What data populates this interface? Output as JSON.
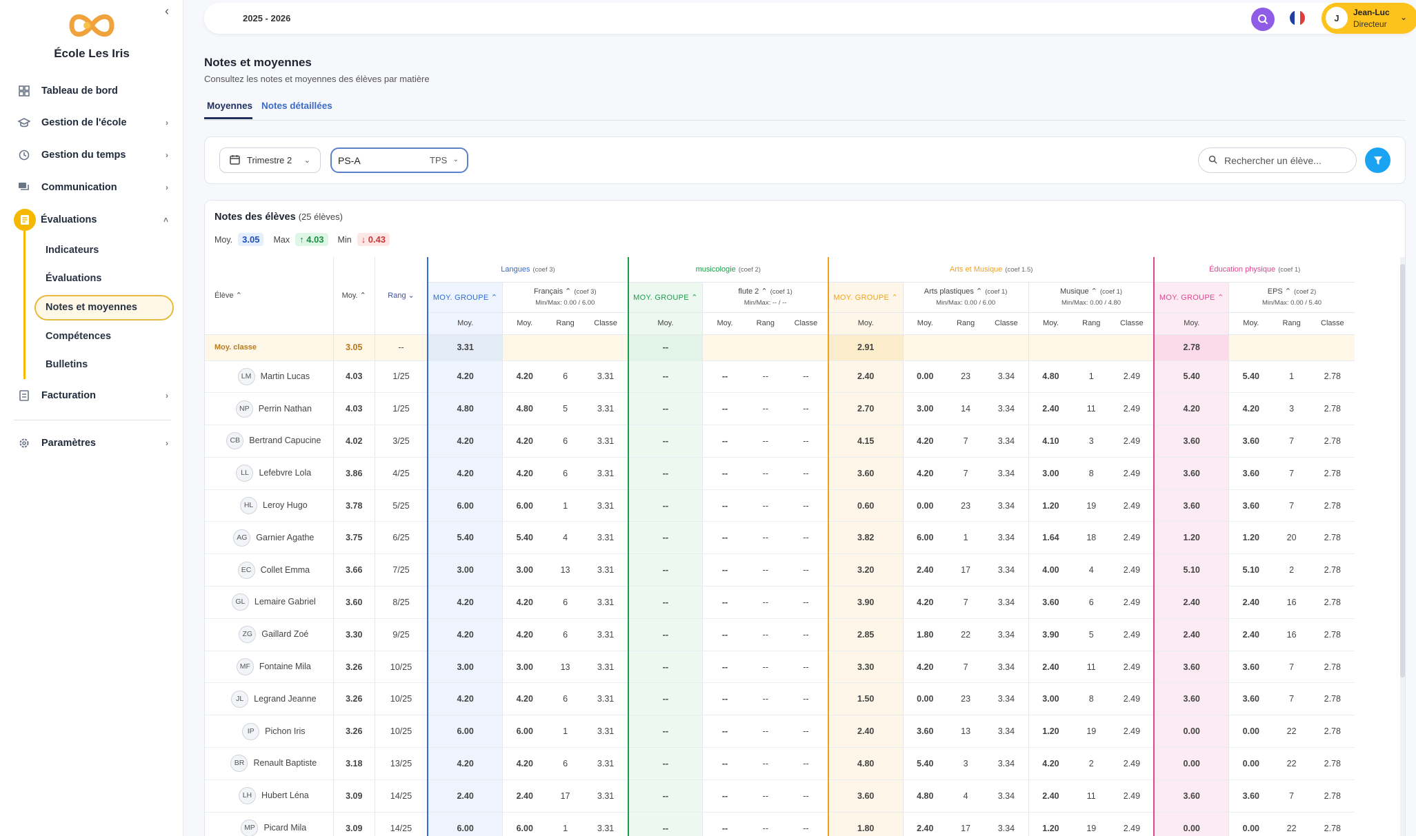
{
  "app": {
    "school": "École Les Iris",
    "year": "2025 - 2026"
  },
  "user": {
    "initial": "J",
    "name": "Jean-Luc",
    "role": "Directeur"
  },
  "sidebar": {
    "items": [
      {
        "label": "Tableau de bord"
      },
      {
        "label": "Gestion de l'école"
      },
      {
        "label": "Gestion du temps"
      },
      {
        "label": "Communication"
      },
      {
        "label": "Évaluations"
      },
      {
        "label": "Facturation"
      },
      {
        "label": "Paramètres"
      }
    ],
    "sub": [
      {
        "label": "Indicateurs"
      },
      {
        "label": "Évaluations"
      },
      {
        "label": "Notes et moyennes"
      },
      {
        "label": "Compétences"
      },
      {
        "label": "Bulletins"
      }
    ]
  },
  "page": {
    "title": "Notes et moyennes",
    "subtitle": "Consultez les notes et moyennes des élèves par matière",
    "tabs": [
      "Moyennes",
      "Notes détaillées"
    ]
  },
  "filters": {
    "trimestre": "Trimestre 2",
    "classe": "PS-A",
    "level": "TPS",
    "search_placeholder": "Rechercher un élève..."
  },
  "card": {
    "title": "Notes des élèves",
    "count": "(25 élèves)",
    "moy_label": "Moy.",
    "moy": "3.05",
    "max_label": "Max",
    "max": "↑ 4.03",
    "min_label": "Min",
    "min": "↓ 0.43"
  },
  "table": {
    "col_eleve": "Élève ⌃",
    "col_moy": "Moy. ⌃",
    "col_rang": "Rang ⌄",
    "groups": [
      {
        "name": "Langues",
        "coef": "(coef 3)"
      },
      {
        "name": "musicologie",
        "coef": "(coef 2)"
      },
      {
        "name": "Arts et Musique",
        "coef": "(coef 1.5)"
      },
      {
        "name": "Éducation physique",
        "coef": "(coef 1)"
      }
    ],
    "moy_groupe": "MOY. GROUPE ⌃",
    "subjects": [
      {
        "name": "Français",
        "coef": "(coef 3)",
        "minmax": "Min/Max: 0.00 / 6.00"
      },
      {
        "name": "flute 2",
        "coef": "(coef 1)",
        "minmax": "Min/Max: -- / --"
      },
      {
        "name": "Arts plastiques",
        "coef": "(coef 1)",
        "minmax": "Min/Max: 0.00 / 6.00"
      },
      {
        "name": "Musique",
        "coef": "(coef 1)",
        "minmax": "Min/Max: 0.00 / 4.80"
      },
      {
        "name": "EPS",
        "coef": "(coef 2)",
        "minmax": "Min/Max: 0.00 / 5.40"
      }
    ],
    "sub_moy": "Moy.",
    "sub_rang": "Rang",
    "sub_classe": "Classe",
    "avg_row": [
      "Moy. classe",
      "3.05",
      "--",
      "3.31",
      "--",
      "2.91",
      "2.78"
    ],
    "rows": [
      [
        "LM",
        "Martin Lucas",
        "4.03",
        "1/25",
        "4.20",
        "4.20",
        "6",
        "3.31",
        "--",
        "--",
        "--",
        "--",
        "2.40",
        "0.00",
        "23",
        "3.34",
        "4.80",
        "1",
        "2.49",
        "5.40",
        "5.40",
        "1",
        "2.78"
      ],
      [
        "NP",
        "Perrin Nathan",
        "4.03",
        "1/25",
        "4.80",
        "4.80",
        "5",
        "3.31",
        "--",
        "--",
        "--",
        "--",
        "2.70",
        "3.00",
        "14",
        "3.34",
        "2.40",
        "11",
        "2.49",
        "4.20",
        "4.20",
        "3",
        "2.78"
      ],
      [
        "CB",
        "Bertrand Capucine",
        "4.02",
        "3/25",
        "4.20",
        "4.20",
        "6",
        "3.31",
        "--",
        "--",
        "--",
        "--",
        "4.15",
        "4.20",
        "7",
        "3.34",
        "4.10",
        "3",
        "2.49",
        "3.60",
        "3.60",
        "7",
        "2.78"
      ],
      [
        "LL",
        "Lefebvre Lola",
        "3.86",
        "4/25",
        "4.20",
        "4.20",
        "6",
        "3.31",
        "--",
        "--",
        "--",
        "--",
        "3.60",
        "4.20",
        "7",
        "3.34",
        "3.00",
        "8",
        "2.49",
        "3.60",
        "3.60",
        "7",
        "2.78"
      ],
      [
        "HL",
        "Leroy Hugo",
        "3.78",
        "5/25",
        "6.00",
        "6.00",
        "1",
        "3.31",
        "--",
        "--",
        "--",
        "--",
        "0.60",
        "0.00",
        "23",
        "3.34",
        "1.20",
        "19",
        "2.49",
        "3.60",
        "3.60",
        "7",
        "2.78"
      ],
      [
        "AG",
        "Garnier Agathe",
        "3.75",
        "6/25",
        "5.40",
        "5.40",
        "4",
        "3.31",
        "--",
        "--",
        "--",
        "--",
        "3.82",
        "6.00",
        "1",
        "3.34",
        "1.64",
        "18",
        "2.49",
        "1.20",
        "1.20",
        "20",
        "2.78"
      ],
      [
        "EC",
        "Collet Emma",
        "3.66",
        "7/25",
        "3.00",
        "3.00",
        "13",
        "3.31",
        "--",
        "--",
        "--",
        "--",
        "3.20",
        "2.40",
        "17",
        "3.34",
        "4.00",
        "4",
        "2.49",
        "5.10",
        "5.10",
        "2",
        "2.78"
      ],
      [
        "GL",
        "Lemaire Gabriel",
        "3.60",
        "8/25",
        "4.20",
        "4.20",
        "6",
        "3.31",
        "--",
        "--",
        "--",
        "--",
        "3.90",
        "4.20",
        "7",
        "3.34",
        "3.60",
        "6",
        "2.49",
        "2.40",
        "2.40",
        "16",
        "2.78"
      ],
      [
        "ZG",
        "Gaillard Zoé",
        "3.30",
        "9/25",
        "4.20",
        "4.20",
        "6",
        "3.31",
        "--",
        "--",
        "--",
        "--",
        "2.85",
        "1.80",
        "22",
        "3.34",
        "3.90",
        "5",
        "2.49",
        "2.40",
        "2.40",
        "16",
        "2.78"
      ],
      [
        "MF",
        "Fontaine Mila",
        "3.26",
        "10/25",
        "3.00",
        "3.00",
        "13",
        "3.31",
        "--",
        "--",
        "--",
        "--",
        "3.30",
        "4.20",
        "7",
        "3.34",
        "2.40",
        "11",
        "2.49",
        "3.60",
        "3.60",
        "7",
        "2.78"
      ],
      [
        "JL",
        "Legrand Jeanne",
        "3.26",
        "10/25",
        "4.20",
        "4.20",
        "6",
        "3.31",
        "--",
        "--",
        "--",
        "--",
        "1.50",
        "0.00",
        "23",
        "3.34",
        "3.00",
        "8",
        "2.49",
        "3.60",
        "3.60",
        "7",
        "2.78"
      ],
      [
        "IP",
        "Pichon Iris",
        "3.26",
        "10/25",
        "6.00",
        "6.00",
        "1",
        "3.31",
        "--",
        "--",
        "--",
        "--",
        "2.40",
        "3.60",
        "13",
        "3.34",
        "1.20",
        "19",
        "2.49",
        "0.00",
        "0.00",
        "22",
        "2.78"
      ],
      [
        "BR",
        "Renault Baptiste",
        "3.18",
        "13/25",
        "4.20",
        "4.20",
        "6",
        "3.31",
        "--",
        "--",
        "--",
        "--",
        "4.80",
        "5.40",
        "3",
        "3.34",
        "4.20",
        "2",
        "2.49",
        "0.00",
        "0.00",
        "22",
        "2.78"
      ],
      [
        "LH",
        "Hubert Léna",
        "3.09",
        "14/25",
        "2.40",
        "2.40",
        "17",
        "3.31",
        "--",
        "--",
        "--",
        "--",
        "3.60",
        "4.80",
        "4",
        "3.34",
        "2.40",
        "11",
        "2.49",
        "3.60",
        "3.60",
        "7",
        "2.78"
      ],
      [
        "MP",
        "Picard Mila",
        "3.09",
        "14/25",
        "6.00",
        "6.00",
        "1",
        "3.31",
        "--",
        "--",
        "--",
        "--",
        "1.80",
        "2.40",
        "17",
        "3.34",
        "1.20",
        "19",
        "2.49",
        "0.00",
        "0.00",
        "22",
        "2.78"
      ]
    ]
  },
  "colors": {
    "accent": "#f5b800",
    "langues": "#2f6bd9",
    "musicologie": "#1a9d49",
    "arts": "#efa21a",
    "eps": "#e04590"
  }
}
